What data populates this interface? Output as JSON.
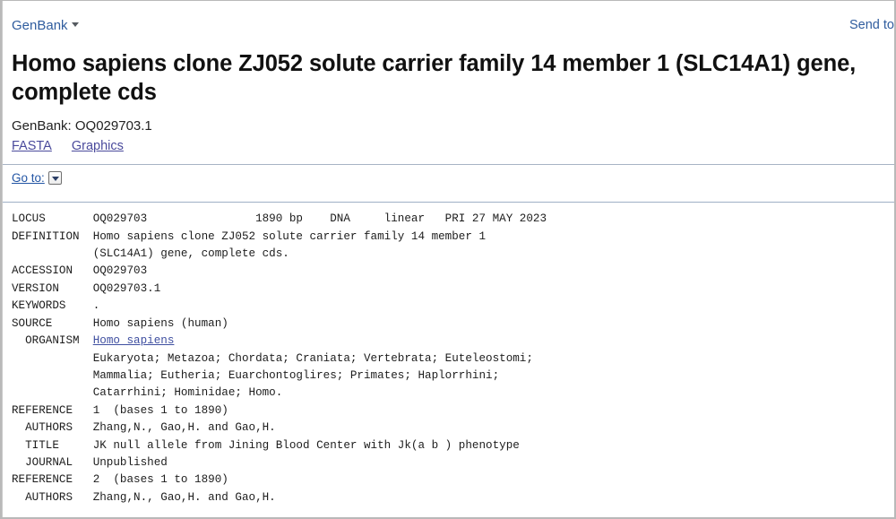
{
  "topbar": {
    "database_label": "GenBank",
    "database_caret_icon": "caret-down-icon",
    "send_to_label": "Send to:"
  },
  "record": {
    "title": "Homo sapiens clone ZJ052 solute carrier family 14 member 1 (SLC14A1) gene, complete cds",
    "accession_line": "GenBank: OQ029703.1",
    "links": [
      {
        "label": "FASTA",
        "name": "fasta-link"
      },
      {
        "label": "Graphics",
        "name": "graphics-link"
      }
    ]
  },
  "goto": {
    "label": "Go to:",
    "icon": "chevron-down-icon"
  },
  "flatfile": {
    "lines": [
      "LOCUS       OQ029703                1890 bp    DNA     linear   PRI 27 MAY 2023",
      "DEFINITION  Homo sapiens clone ZJ052 solute carrier family 14 member 1",
      "            (SLC14A1) gene, complete cds.",
      "ACCESSION   OQ029703",
      "VERSION     OQ029703.1",
      "KEYWORDS    .",
      "SOURCE      Homo sapiens (human)",
      "  ORGANISM  Homo sapiens",
      "            Eukaryota; Metazoa; Chordata; Craniata; Vertebrata; Euteleostomi;",
      "            Mammalia; Eutheria; Euarchontoglires; Primates; Haplorrhini;",
      "            Catarrhini; Hominidae; Homo.",
      "REFERENCE   1  (bases 1 to 1890)",
      "  AUTHORS   Zhang,N., Gao,H. and Gao,H.",
      "  TITLE     JK null allele from Jining Blood Center with Jk(a b ) phenotype",
      "  JOURNAL   Unpublished",
      "REFERENCE   2  (bases 1 to 1890)",
      "  AUTHORS   Zhang,N., Gao,H. and Gao,H."
    ],
    "organism_link_text": "Homo sapiens",
    "organism_line_index": 7,
    "organism_prefix": "  ORGANISM  "
  },
  "colors": {
    "link_blue": "#2f5c9e",
    "flatfile_link": "#3f4fa0",
    "rule": "#a7b3c4",
    "page_border": "#b9b9b9"
  }
}
